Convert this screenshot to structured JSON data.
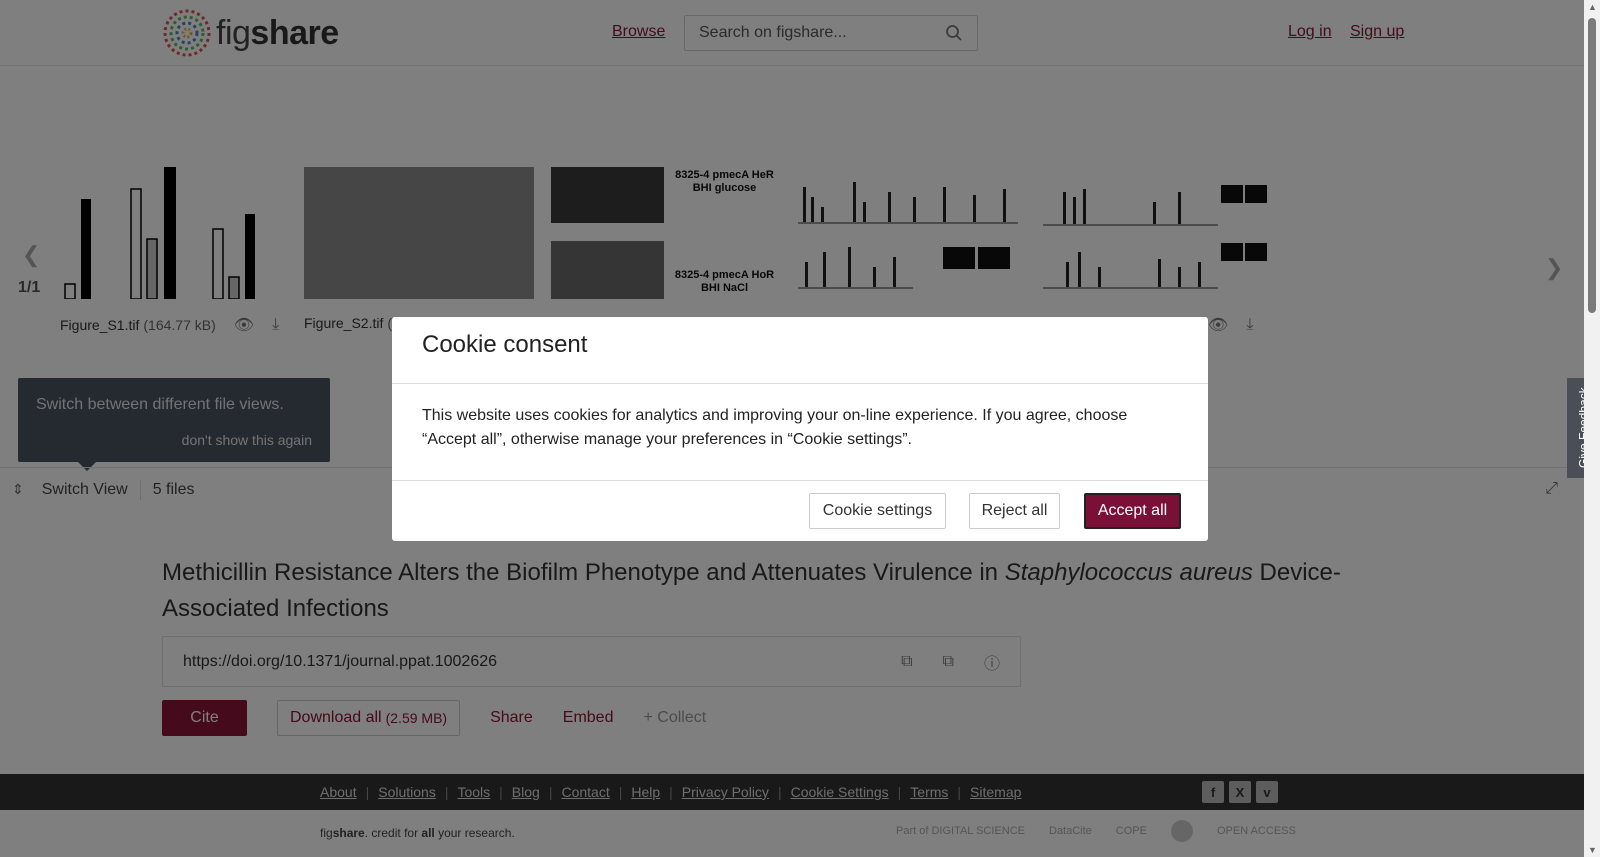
{
  "header": {
    "logo_text_regular": "fig",
    "logo_text_bold": "share",
    "browse_label": "Browse",
    "search_placeholder": "Search on figshare...",
    "login_label": "Log in",
    "signup_label": "Sign up"
  },
  "viewer": {
    "pager_count": "1/1",
    "files": [
      {
        "name": "Figure_S1.tif",
        "size": "(164.77 kB)"
      },
      {
        "name": "Figure_S2.tif",
        "size": "("
      }
    ],
    "thumb3_label_1": "8325-4 pmecA HeR",
    "thumb3_label_2": "BHI glucose",
    "thumb3_label_3": "8325-4 pmecA HoR",
    "thumb3_label_4": "BHI NaCl",
    "tooltip_text": "Switch between different file views.",
    "tooltip_dismiss": "don't show this again",
    "switch_view_label": "Switch View",
    "file_count": "5 files"
  },
  "article": {
    "title_part1": "Methicillin Resistance Alters the Biofilm Phenotype and Attenuates Virulence in ",
    "title_italic": "Staphylococcus aureus",
    "title_part2": " Device-Associated Infections",
    "doi": "https://doi.org/10.1371/journal.ppat.1002626",
    "cite_label": "Cite",
    "download_label": "Download all",
    "download_size": "(2.59 MB)",
    "share_label": "Share",
    "embed_label": "Embed",
    "collect_label": "+ Collect"
  },
  "footer": {
    "links": [
      "About",
      "Solutions",
      "Tools",
      "Blog",
      "Contact",
      "Help",
      "Privacy Policy",
      "Cookie Settings",
      "Terms",
      "Sitemap"
    ],
    "credit_pre": "fig",
    "credit_bold": "share",
    "credit_mid": ". credit for ",
    "credit_all": "all",
    "credit_post": " your research.",
    "partner_1": "Part of DIGITAL SCIENCE",
    "partner_2": "DataCite",
    "partner_3": "COPE",
    "partner_5": "OPEN ACCESS"
  },
  "cookie_modal": {
    "title": "Cookie consent",
    "body": "This website uses cookies for analytics and improving your on-line experience. If you agree, choose “Accept all”, otherwise manage your preferences in “Cookie settings”.",
    "settings_label": "Cookie settings",
    "reject_label": "Reject all",
    "accept_label": "Accept all"
  },
  "feedback_label": "Give Feedback",
  "colors": {
    "brand": "#8a1538",
    "footer_bg": "#333333",
    "tooltip_bg": "#4a5361"
  }
}
